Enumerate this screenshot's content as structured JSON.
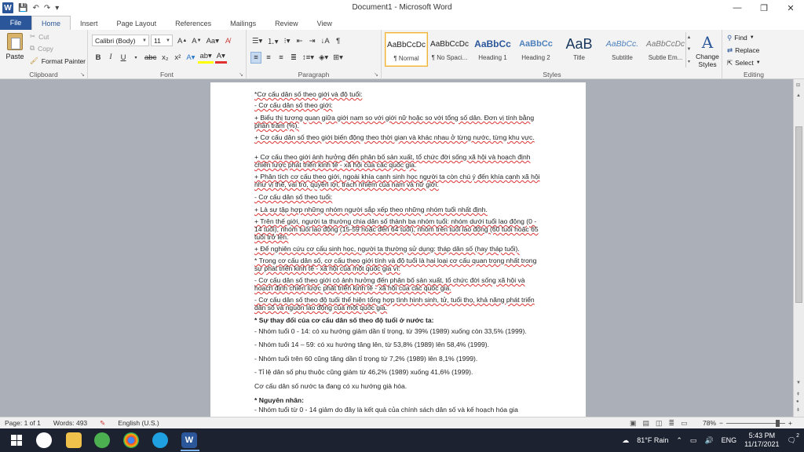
{
  "window": {
    "title": "Document1 - Microsoft Word",
    "logo": "W",
    "controls": [
      "—",
      "❐",
      "✕"
    ]
  },
  "quick_access": {
    "icons": [
      "save-icon",
      "undo-icon",
      "redo-icon",
      "customize-icon"
    ]
  },
  "tabs": [
    {
      "label": "File"
    },
    {
      "label": "Home"
    },
    {
      "label": "Insert"
    },
    {
      "label": "Page Layout"
    },
    {
      "label": "References"
    },
    {
      "label": "Mailings"
    },
    {
      "label": "Review"
    },
    {
      "label": "View"
    }
  ],
  "ribbon": {
    "clipboard": {
      "label": "Clipboard",
      "paste": "Paste",
      "cut": "Cut",
      "copy": "Copy",
      "format_painter": "Format Painter"
    },
    "font": {
      "label": "Font",
      "family": "Calibri (Body)",
      "size": "11"
    },
    "paragraph": {
      "label": "Paragraph"
    },
    "styles": {
      "label": "Styles",
      "items": [
        {
          "sample": "AaBbCcDc",
          "name": "¶ Normal"
        },
        {
          "sample": "AaBbCcDc",
          "name": "¶ No Spaci..."
        },
        {
          "sample": "AaBbCc",
          "name": "Heading 1"
        },
        {
          "sample": "AaBbCc",
          "name": "Heading 2"
        },
        {
          "sample": "AaB",
          "name": "Title"
        },
        {
          "sample": "AaBbCc.",
          "name": "Subtitle"
        },
        {
          "sample": "AaBbCcDc",
          "name": "Subtle Em..."
        }
      ],
      "change_styles": "Change Styles"
    },
    "editing": {
      "label": "Editing",
      "find": "Find",
      "replace": "Replace",
      "select": "Select"
    }
  },
  "document": {
    "paragraphs": [
      "*Cơ cấu dân số theo giới và độ tuổi:",
      "-  Cơ cấu dân số theo giới:",
      "+ Biểu thị tương quan giữa giới nam so với giới nữ  hoặc so với tổng số dân. Đơn vị tính bằng phần trăm (%).",
      "+ Cơ cấu dân số theo giới biến động theo thời gian và khác nhau ở từng nước, từng khu vực.",
      "+ Cơ cấu theo giới ảnh hưởng đến phân bố sản xuất, tổ chức đời sống xã hội và hoạch định chiến lược phát triển kinh tế - xã hội của các quốc gia.",
      "+ Phân tích cơ cấu theo giới, ngoài khía cạnh sinh học người ta còn chú ý đến khía cạnh xã hội như vị thế, vai trò, quyền lợi, trách nhiệm của nam và nữ giới.",
      "- Cơ cấu dân số theo tuổi:",
      "+ Là sự tập hợp những nhóm người sắp xếp theo những nhóm tuổi nhất định.",
      "+ Trên thế giới, người ta thường chia dân số thành ba nhóm tuổi: nhóm dưới tuổi lao động (0 - 14 tuổi), nhóm tuổi lao động (15-59 hoặc đến 64 tuổi), nhóm trên tuổi lao động (60 tuổi hoặc 65 tuổi trở lên.",
      "+ Để nghiên cứu cơ cấu sinh học, người ta thường sử dụng: tháp dân số (hay tháp tuổi).",
      "* Trong cơ cấu dân số, cơ cấu theo giới tính và độ tuổi là hai loại cơ cấu quan trọng nhất trong sự phát triển kinh tế - xã hội của một quốc gia vì:",
      "- Cơ cấu dân số theo giới có ảnh hưởng đến phân bố sản xuất, tổ chức đời sống xã hội và hoạch định chiến lược phát triển kinh tế - xã hội của các quốc gia.",
      "- Cơ cấu dân số theo độ tuổi thể hiện tổng hợp tình hình sinh, tử, tuổi thọ, khả năng phát triển dân số và nguồn lao động của một quốc gia.",
      " * Sự thay đổi của cơ cấu dân số theo độ tuổi ở nước ta:",
      "- Nhóm tuổi 0 - 14: có xu hướng giảm dần tỉ trọng, từ 39% (1989) xuống còn 33,5% (1999).",
      "- Nhóm tuổi 14 – 59:  có xu hướng tăng lên, từ 53,8% (1989) lên 58,4% (1999).",
      "- Nhóm tuổi trên 60 cũng tăng dần tỉ trọng từ 7,2% (1989) lên 8,1% (1999).",
      "- Tỉ lệ dân số phụ thuộc cũng giảm từ 46,2% (1989) xuống 41,6% (1999).",
      "Cơ cấu dân số nước ta đang có xu hướng già hóa.",
      "* Nguyên nhân:",
      "- Nhóm tuổi từ 0 - 14 giảm do đây là kết quả của chính sách dân số và kế hoạch hóa gia"
    ]
  },
  "status": {
    "page": "Page: 1 of 1",
    "words": "Words: 493",
    "language": "English (U.S.)",
    "zoom": "78%",
    "zoom_minus": "−",
    "zoom_plus": "+"
  },
  "taskbar": {
    "weather": "81°F  Rain",
    "lang": "ENG",
    "time": "5:43 PM",
    "date": "11/17/2021",
    "notification_count": "2"
  },
  "colors": {
    "accent": "#2b579a",
    "taskbar": "#1c2230"
  }
}
